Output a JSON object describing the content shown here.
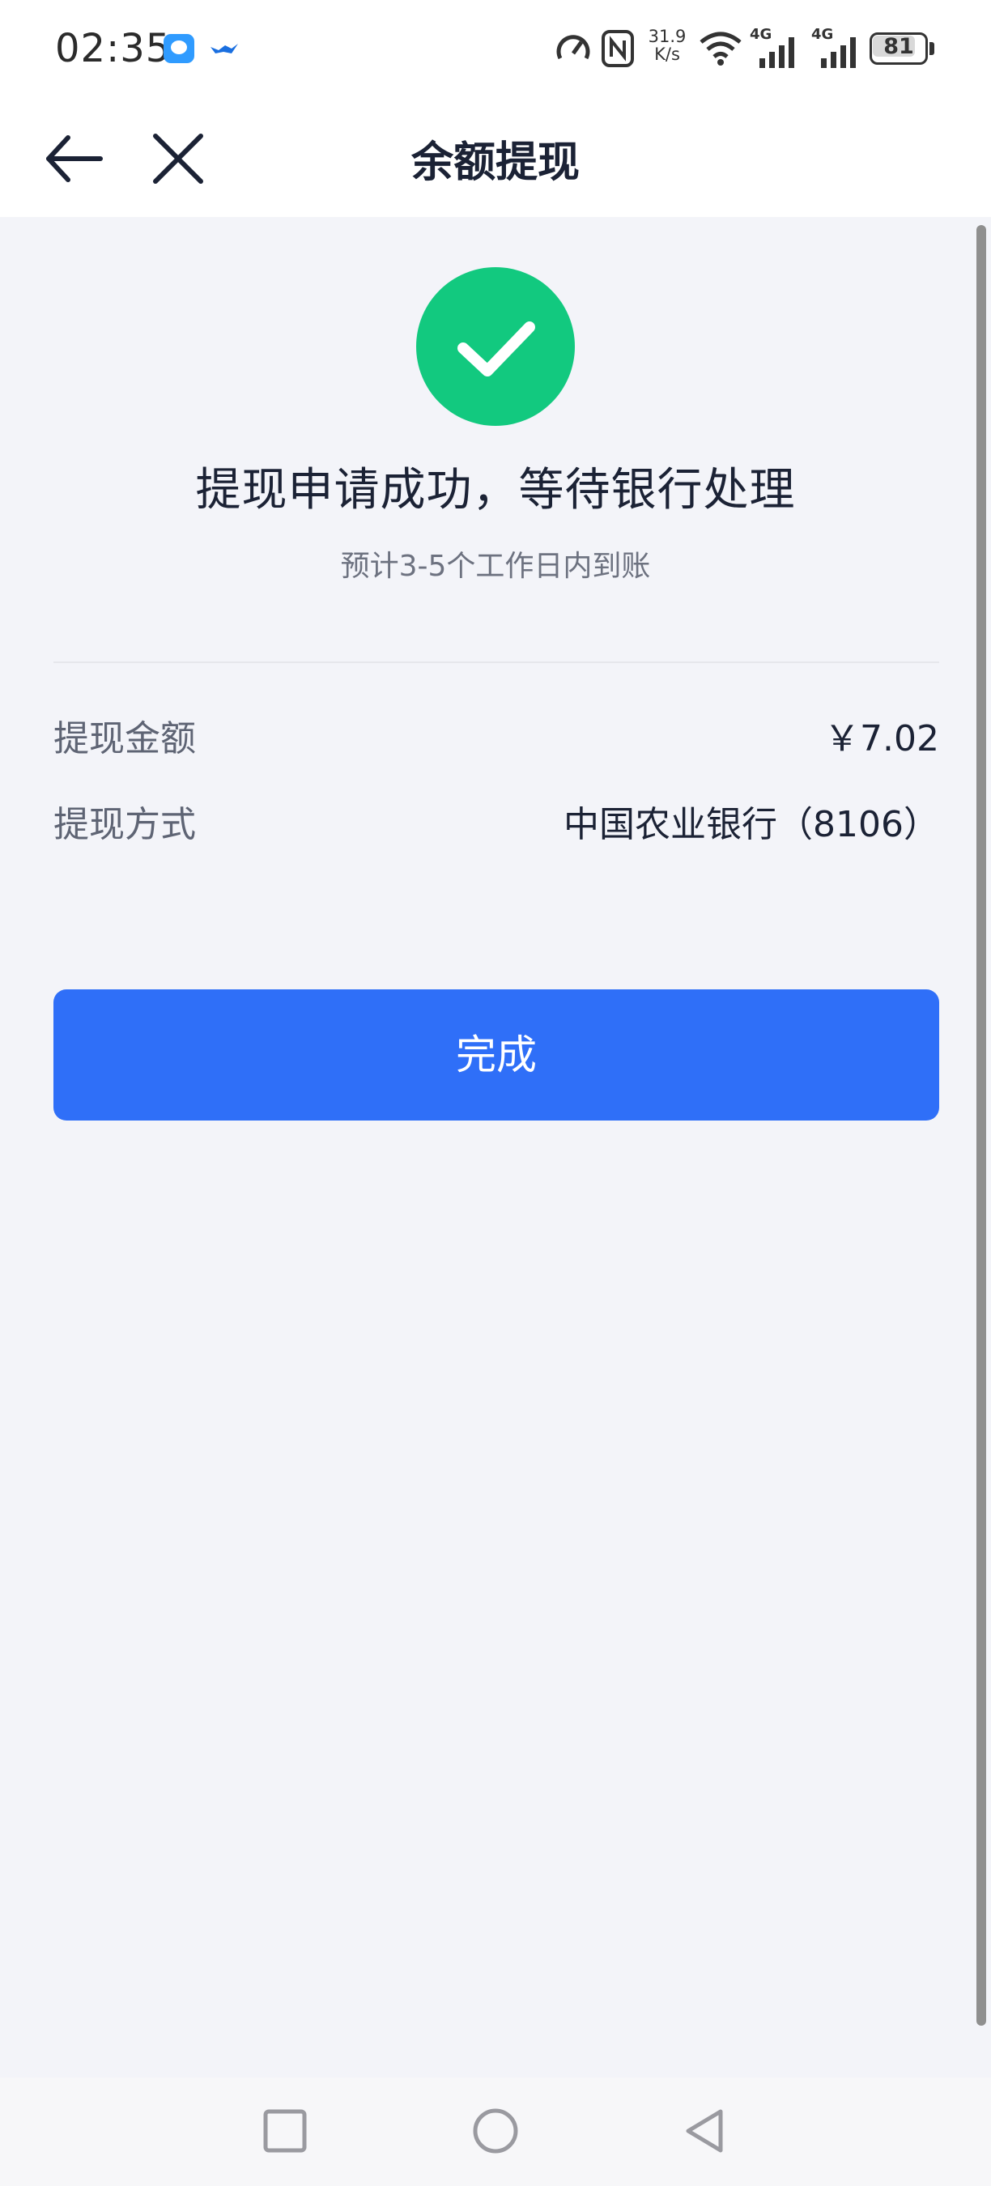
{
  "status_bar": {
    "time": "02:35",
    "speed_value": "31.9",
    "speed_unit": "K/s",
    "network_1": "4G",
    "network_2": "4G",
    "battery": "81",
    "battery_level": 0.81
  },
  "nav": {
    "title": "余额提现"
  },
  "result": {
    "title": "提现申请成功，等待银行处理",
    "subtitle": "预计3-5个工作日内到账"
  },
  "details": [
    {
      "label": "提现金额",
      "value": "￥7.02"
    },
    {
      "label": "提现方式",
      "value": "中国农业银行（8106）"
    }
  ],
  "done_button": "完成",
  "colors": {
    "accent": "#2f6ff8",
    "success": "#12c97f",
    "background": "#f3f4f9",
    "text_primary": "#1b2235",
    "text_secondary": "#6d7280"
  },
  "icons": {
    "back": "arrow-left-icon",
    "close": "close-icon",
    "success": "checkmark-circle-icon",
    "recents": "square-icon",
    "home": "circle-icon",
    "system_back": "triangle-left-icon"
  }
}
